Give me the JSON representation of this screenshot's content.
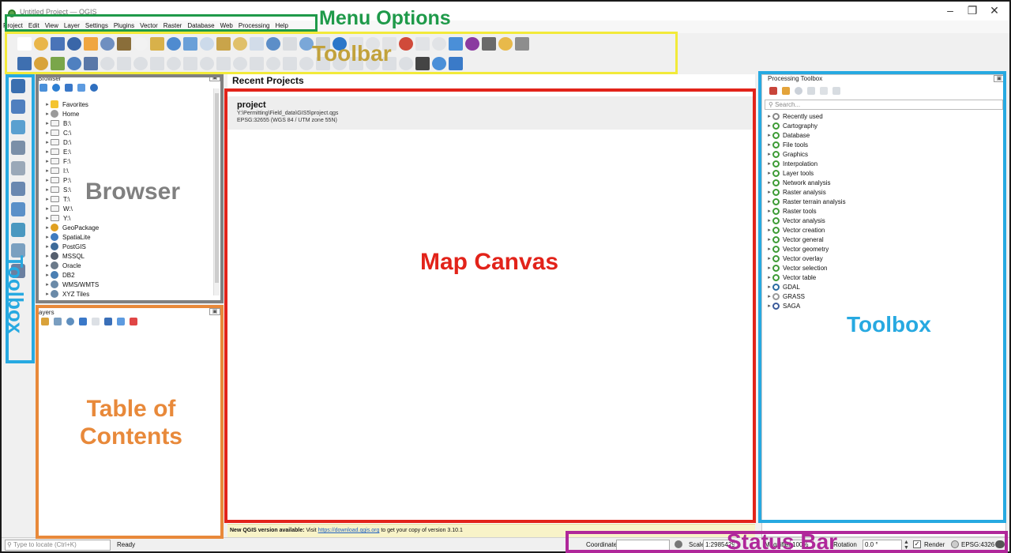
{
  "window": {
    "title": "Untitled Project — QGIS",
    "minimize_glyph": "–",
    "restore_glyph": "❐",
    "close_glyph": "✕"
  },
  "menu": {
    "items": [
      "Project",
      "Edit",
      "View",
      "Layer",
      "Settings",
      "Plugins",
      "Vector",
      "Raster",
      "Database",
      "Web",
      "Processing",
      "Help"
    ]
  },
  "annotations": {
    "menu": "Menu Options",
    "toolbar": "Toolbar",
    "toolbox_left": "Toolbox",
    "browser": "Browser",
    "map_canvas": "Map Canvas",
    "toolbox_right": "Toolbox",
    "table_of_contents": "Table of Contents",
    "status_bar": "Status Bar"
  },
  "colors": {
    "menu_annotation": "#1f9a4a",
    "toolbar_annotation": "#f2ea3a",
    "toolbar_label": "#c2a23c",
    "toolbox_annotation": "#27a9e1",
    "browser_annotation": "#808080",
    "map_canvas_annotation": "#e2231a",
    "table_of_contents_annotation": "#e8893a",
    "status_bar_annotation": "#b0279a"
  },
  "browser": {
    "title": "Browser",
    "items": [
      {
        "label": "Favorites",
        "icon": "star-icon"
      },
      {
        "label": "Home",
        "icon": "home-icon"
      },
      {
        "label": "B:\\",
        "icon": "folder-icon"
      },
      {
        "label": "C:\\",
        "icon": "folder-icon"
      },
      {
        "label": "D:\\",
        "icon": "folder-icon"
      },
      {
        "label": "E:\\",
        "icon": "folder-icon"
      },
      {
        "label": "F:\\",
        "icon": "folder-icon"
      },
      {
        "label": "I:\\",
        "icon": "folder-icon"
      },
      {
        "label": "P:\\",
        "icon": "folder-icon"
      },
      {
        "label": "S:\\",
        "icon": "folder-icon"
      },
      {
        "label": "T:\\",
        "icon": "folder-icon"
      },
      {
        "label": "W:\\",
        "icon": "folder-icon"
      },
      {
        "label": "Y:\\",
        "icon": "folder-icon"
      },
      {
        "label": "GeoPackage",
        "icon": "geopackage-icon"
      },
      {
        "label": "SpatiaLite",
        "icon": "spatialite-icon"
      },
      {
        "label": "PostGIS",
        "icon": "postgis-icon"
      },
      {
        "label": "MSSQL",
        "icon": "mssql-icon"
      },
      {
        "label": "Oracle",
        "icon": "oracle-icon"
      },
      {
        "label": "DB2",
        "icon": "db2-icon"
      },
      {
        "label": "WMS/WMTS",
        "icon": "globe-icon"
      },
      {
        "label": "XYZ Tiles",
        "icon": "globe-icon"
      }
    ]
  },
  "layers": {
    "title": "ayers"
  },
  "recent_projects": {
    "heading": "Recent Projects",
    "project": {
      "name": "project",
      "path": "Y:\\Permitting\\Field_data\\GIS5\\project.qgs",
      "crs": "EPSG:32655 (WGS 84 / UTM zone 55N)"
    }
  },
  "update_notice": {
    "prefix": "New QGIS version available:",
    "middle": "Visit",
    "link": "https://download.qgis.org",
    "suffix": "to get your copy of version 3.10.1"
  },
  "processing_toolbox": {
    "title": "Processing Toolbox",
    "search_placeholder": "Search...",
    "items": [
      "Recently used",
      "Cartography",
      "Database",
      "File tools",
      "Graphics",
      "Interpolation",
      "Layer tools",
      "Network analysis",
      "Raster analysis",
      "Raster terrain analysis",
      "Raster tools",
      "Vector analysis",
      "Vector creation",
      "Vector general",
      "Vector geometry",
      "Vector overlay",
      "Vector selection",
      "Vector table",
      "GDAL",
      "GRASS",
      "SAGA"
    ]
  },
  "statusbar": {
    "locate_placeholder": "Type to locate (Ctrl+K)",
    "ready": "Ready",
    "coordinate_label": "Coordinate",
    "scale_label": "Scale",
    "scale_value": "1:29854297",
    "magnifier_label": "Magnifier",
    "magnifier_value": "100%",
    "rotation_label": "Rotation",
    "rotation_value": "0.0 °",
    "render_label": "Render",
    "crs": "EPSG:4326"
  }
}
